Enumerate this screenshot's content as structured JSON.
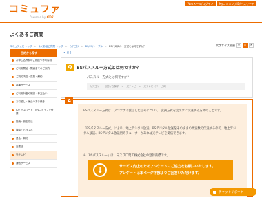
{
  "header": {
    "logo": "コミュファ",
    "logo_sub": "Powered by",
    "logo_brand": "ctc",
    "links": [
      "Webメール/ログイン",
      "MyコミュファID/パスワード"
    ]
  },
  "page_title": "よくあるご質問",
  "breadcrumb": [
    "コミュファ光 トップ",
    "よくあるご質問 トップ",
    "カテゴリ",
    "BS/CS/ケーブル",
    "BSパススルー方式とは何ですか？"
  ],
  "font_size": {
    "label": "文字サイズ変更",
    "options": [
      "小",
      "中",
      "大"
    ],
    "selected": "中"
  },
  "sidebar": {
    "heading": "目的から探す",
    "items": [
      "お申し込み前のご相談や不明な点",
      "ご利用開始・開通までのご案内",
      "ご契約内容・変更・解約",
      "各種サービス",
      "ご利用料金の確認・お支払い",
      "お引越し・休止のお手続き",
      "ID・パスワード・Myコミュファ登録",
      "接続・設定方法",
      "故障・トラブル",
      "退会・解約",
      "光電話",
      "光テレビ",
      "通信サービス"
    ]
  },
  "back_label": "戻る",
  "question": {
    "mark": "Q",
    "title": "BSパススルー方式とは何ですか？",
    "body": "パススルー方式とは何ですか？",
    "categories": [
      "カテゴリー",
      "目的から探す",
      "光テレビ",
      "光テレビ（サービス）"
    ]
  },
  "answer": {
    "mark": "A",
    "p1": "BSパススルー方式は、アンテナで受信した信号について、変調方式を変えずに伝送する方式のことです。",
    "p2": "「BSパススルー方式」により、地上デジタル放送、BSデジタル放送をそのままの周波数で伝送するので、地上デジタル放送、BSデジタル放送用のチューナーがあれば光テレビを受信できます。",
    "p3": "※「BSパススルー」は、マスプロ電工株式会社の登録商標です。"
  },
  "survey": {
    "line1": "サービス向上のためアンケートにご協力をお願いいたします。",
    "line2": "アンケートは本ページ下部よりご回答いただけます。"
  },
  "chat_label": "チャットサポート"
}
